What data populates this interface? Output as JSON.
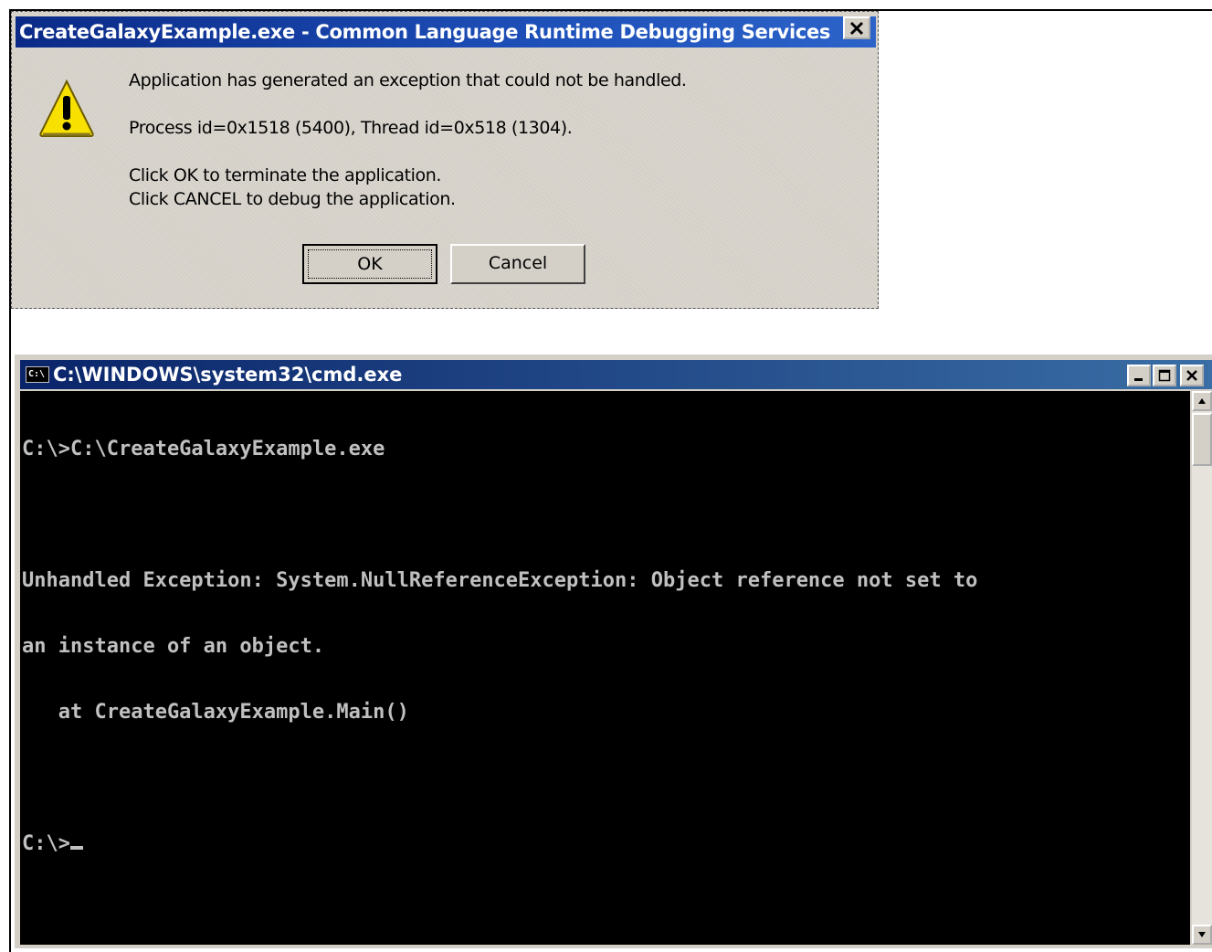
{
  "dialog": {
    "title": "CreateGalaxyExample.exe - Common Language Runtime Debugging Services",
    "message": "Application has generated an exception that could not be handled.",
    "process_info": "Process id=0x1518 (5400), Thread id=0x518 (1304).",
    "instruction_ok": "Click OK to terminate the application.",
    "instruction_cancel": "Click CANCEL to debug the application.",
    "ok_label": "OK",
    "cancel_label": "Cancel",
    "icon": "warning-icon"
  },
  "cmd": {
    "title": "C:\\WINDOWS\\system32\\cmd.exe",
    "icon_text": "C:\\",
    "lines": [
      "C:\\>C:\\CreateGalaxyExample.exe",
      "",
      "Unhandled Exception: System.NullReferenceException: Object reference not set to",
      "an instance of an object.",
      "   at CreateGalaxyExample.Main()",
      ""
    ],
    "prompt": "C:\\>"
  },
  "colors": {
    "dialog_title_bg": "#0b2a87",
    "cmd_title_bg": "#0a246a",
    "console_bg": "#000000",
    "console_fg": "#c0c0c0"
  }
}
